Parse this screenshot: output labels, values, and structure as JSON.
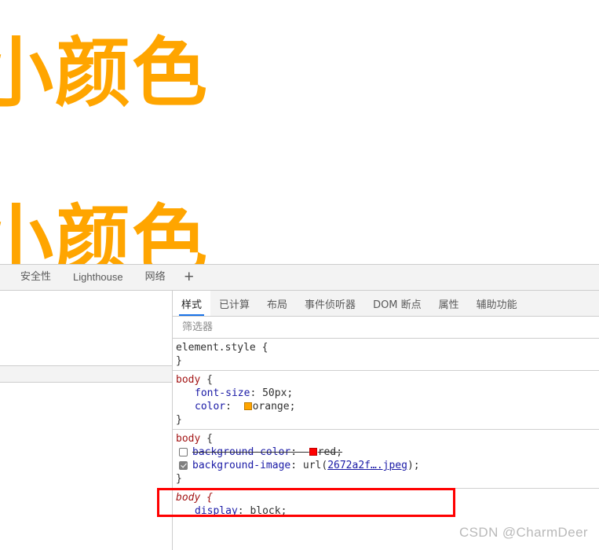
{
  "page": {
    "heading_1": "小颜色",
    "heading_2": "小颜色",
    "orange_hex": "#FFA500"
  },
  "devtools": {
    "toolbar_tabs": [
      {
        "label": "安全性"
      },
      {
        "label": "Lighthouse"
      },
      {
        "label": "网络"
      }
    ],
    "add_tab_glyph": "+",
    "sidebar_tabs": [
      {
        "label": "样式",
        "active": true
      },
      {
        "label": "已计算",
        "active": false
      },
      {
        "label": "布局",
        "active": false
      },
      {
        "label": "事件侦听器",
        "active": false
      },
      {
        "label": "DOM 断点",
        "active": false
      },
      {
        "label": "属性",
        "active": false
      },
      {
        "label": "辅助功能",
        "active": false
      }
    ],
    "filter": {
      "placeholder": "筛选器",
      "value": ""
    },
    "rules": [
      {
        "selector": "element.style",
        "open_brace": "{",
        "close_brace": "}",
        "declarations": []
      },
      {
        "selector": "body",
        "open_brace": "{",
        "close_brace": "}",
        "declarations": [
          {
            "property": "font-size",
            "value": "50px",
            "terminator": ";"
          },
          {
            "property": "color",
            "value": "orange",
            "terminator": ";",
            "swatch": "#FFA500"
          }
        ]
      },
      {
        "selector": "body",
        "open_brace": "{",
        "close_brace": "}",
        "declarations": [
          {
            "property": "background-color",
            "value": "red",
            "terminator": ";",
            "swatch": "#FF0000",
            "checked": false,
            "disabled": true
          },
          {
            "property": "background-image",
            "value_prefix": "url(",
            "link_text": "2672a2f….jpeg",
            "value_suffix": ")",
            "terminator": ";",
            "checked": true,
            "disabled": false
          }
        ]
      },
      {
        "selector": "body",
        "open_brace": "{",
        "close_brace": "",
        "italic": true,
        "declarations": [
          {
            "property": "display",
            "value": "block",
            "terminator": ";"
          }
        ]
      }
    ]
  },
  "annotation": {
    "box_color": "#FF0000"
  },
  "watermark": {
    "text": "CSDN @CharmDeer"
  }
}
